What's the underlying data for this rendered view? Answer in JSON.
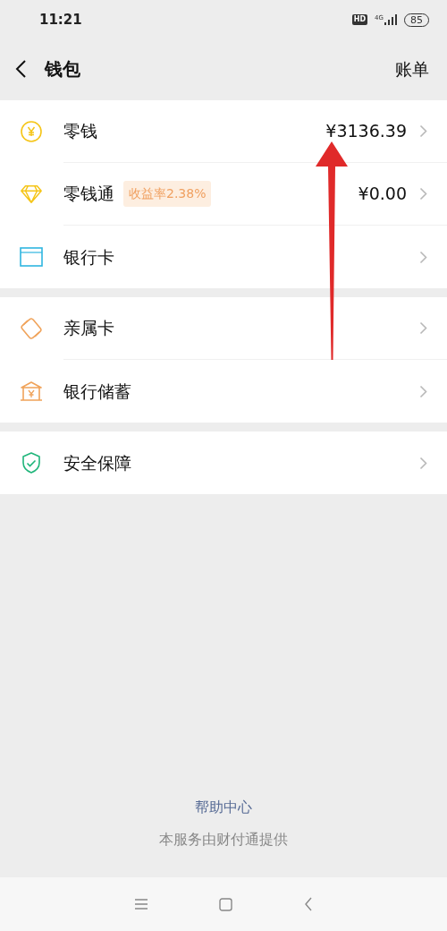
{
  "status_bar": {
    "time": "11:21",
    "hd": "HD",
    "network": "4G",
    "battery": "85"
  },
  "header": {
    "title": "钱包",
    "action": "账单"
  },
  "groups": [
    {
      "rows": [
        {
          "label": "零钱",
          "value": "¥3136.39"
        },
        {
          "label": "零钱通",
          "badge": "收益率2.38%",
          "value": "¥0.00"
        },
        {
          "label": "银行卡"
        }
      ]
    },
    {
      "rows": [
        {
          "label": "亲属卡"
        },
        {
          "label": "银行储蓄"
        }
      ]
    },
    {
      "rows": [
        {
          "label": "安全保障"
        }
      ]
    }
  ],
  "footer": {
    "link": "帮助中心",
    "note": "本服务由财付通提供"
  }
}
